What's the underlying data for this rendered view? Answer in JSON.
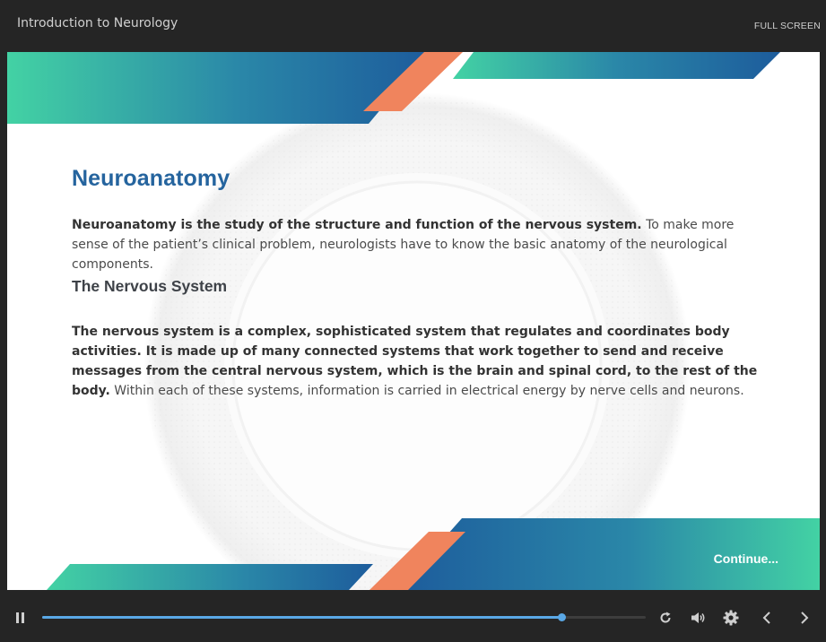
{
  "header": {
    "course_title": "Introduction to Neurology",
    "fullscreen_label": "FULL SCREEN"
  },
  "slide": {
    "heading": "Neuroanatomy",
    "paragraph1_bold": "Neuroanatomy is the study of the structure and function of the nervous system.",
    "paragraph1_rest": " To make more sense of the patient’s clinical problem, neurologists have to know the basic anatomy of the neurological components.",
    "subheading": "The Nervous System",
    "paragraph2_bold": "The nervous system is a complex, sophisticated system that regulates and coordinates body activities. It is made up of many connected systems that work together to send and receive messages from the central nervous system, which is the brain and spinal cord, to the rest of the body.",
    "paragraph2_rest": " Within each of these systems, information is carried in electrical energy by nerve cells and neurons.",
    "continue_label": "Continue...",
    "colors": {
      "heading": "#25649e",
      "accent_orange": "#f0845d",
      "gradient_teal": "#42d1a3",
      "gradient_blue": "#1f5f9e"
    }
  },
  "player": {
    "progress_fraction": 0.86,
    "buffered_fraction": 0.78,
    "icons": {
      "pause": "pause-icon",
      "replay": "replay-icon",
      "volume": "volume-icon",
      "settings": "gear-icon",
      "prev": "chevron-left-icon",
      "next": "chevron-right-icon"
    }
  }
}
